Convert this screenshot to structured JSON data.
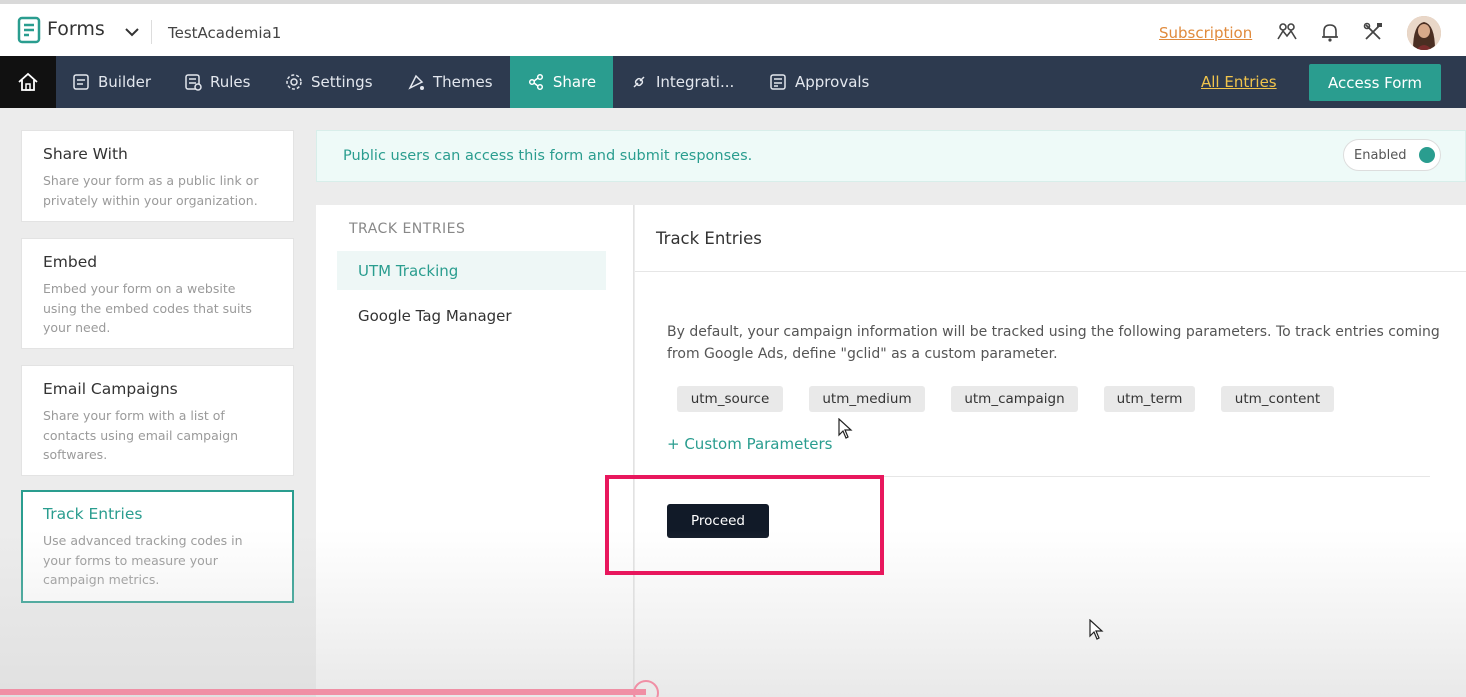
{
  "topbar": {
    "app_name": "Forms",
    "org_name": "TestAcademia1",
    "subscription_label": "Subscription",
    "icons": [
      "users-icon",
      "bell-icon",
      "tools-icon"
    ]
  },
  "nav": {
    "items": [
      {
        "label": "Builder",
        "icon": "builder-icon"
      },
      {
        "label": "Rules",
        "icon": "rules-icon"
      },
      {
        "label": "Settings",
        "icon": "gear-icon"
      },
      {
        "label": "Themes",
        "icon": "themes-icon"
      },
      {
        "label": "Share",
        "icon": "share-icon",
        "active": true
      },
      {
        "label": "Integrati...",
        "icon": "integration-icon"
      },
      {
        "label": "Approvals",
        "icon": "approvals-icon"
      }
    ],
    "all_entries_label": "All Entries",
    "access_form_label": "Access Form"
  },
  "share_options": [
    {
      "title": "Share With",
      "desc": "Share your form as a public link or privately within your organization."
    },
    {
      "title": "Embed",
      "desc": "Embed your form on a website using the embed codes that suits your need."
    },
    {
      "title": "Email Campaigns",
      "desc": "Share your form with a list of contacts using email campaign softwares."
    },
    {
      "title": "Track Entries",
      "desc": "Use advanced tracking codes in your forms to measure your campaign metrics.",
      "selected": true
    }
  ],
  "banner": {
    "text": "Public users can access this form and submit responses.",
    "toggle_label": "Enabled",
    "toggle_on": true
  },
  "track_menu": {
    "heading": "TRACK ENTRIES",
    "items": [
      {
        "label": "UTM Tracking",
        "active": true
      },
      {
        "label": "Google Tag Manager"
      }
    ]
  },
  "track_panel": {
    "title": "Track Entries",
    "description": "By default, your campaign information will be tracked using the following parameters. To track entries coming from Google Ads, define \"gclid\" as a custom parameter.",
    "parameters": [
      "utm_source",
      "utm_medium",
      "utm_campaign",
      "utm_term",
      "utm_content"
    ],
    "custom_params_label": "+ Custom Parameters",
    "proceed_label": "Proceed"
  },
  "colors": {
    "accent": "#2a9d8f",
    "nav_bg": "#2d3a4f",
    "highlight": "#e8175d",
    "subscription": "#e08a3c",
    "all_entries": "#f0c44c"
  }
}
